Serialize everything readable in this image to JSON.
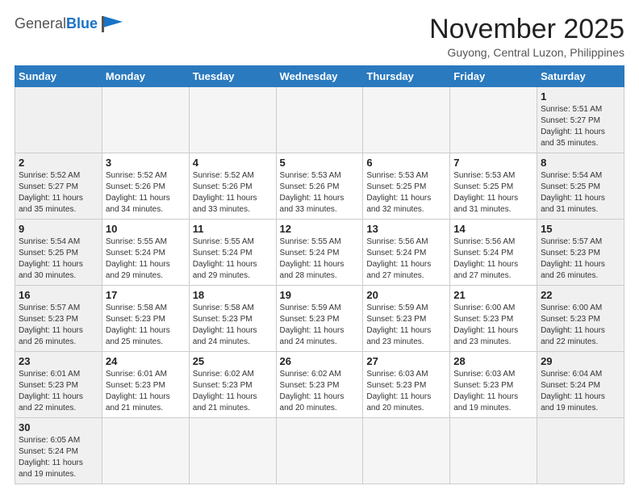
{
  "header": {
    "logo_general": "General",
    "logo_blue": "Blue",
    "month_title": "November 2025",
    "location": "Guyong, Central Luzon, Philippines"
  },
  "weekdays": [
    "Sunday",
    "Monday",
    "Tuesday",
    "Wednesday",
    "Thursday",
    "Friday",
    "Saturday"
  ],
  "weeks": [
    [
      {
        "day": "",
        "info": ""
      },
      {
        "day": "",
        "info": ""
      },
      {
        "day": "",
        "info": ""
      },
      {
        "day": "",
        "info": ""
      },
      {
        "day": "",
        "info": ""
      },
      {
        "day": "",
        "info": ""
      },
      {
        "day": "1",
        "info": "Sunrise: 5:51 AM\nSunset: 5:27 PM\nDaylight: 11 hours\nand 35 minutes."
      }
    ],
    [
      {
        "day": "2",
        "info": "Sunrise: 5:52 AM\nSunset: 5:27 PM\nDaylight: 11 hours\nand 35 minutes."
      },
      {
        "day": "3",
        "info": "Sunrise: 5:52 AM\nSunset: 5:26 PM\nDaylight: 11 hours\nand 34 minutes."
      },
      {
        "day": "4",
        "info": "Sunrise: 5:52 AM\nSunset: 5:26 PM\nDaylight: 11 hours\nand 33 minutes."
      },
      {
        "day": "5",
        "info": "Sunrise: 5:53 AM\nSunset: 5:26 PM\nDaylight: 11 hours\nand 33 minutes."
      },
      {
        "day": "6",
        "info": "Sunrise: 5:53 AM\nSunset: 5:25 PM\nDaylight: 11 hours\nand 32 minutes."
      },
      {
        "day": "7",
        "info": "Sunrise: 5:53 AM\nSunset: 5:25 PM\nDaylight: 11 hours\nand 31 minutes."
      },
      {
        "day": "8",
        "info": "Sunrise: 5:54 AM\nSunset: 5:25 PM\nDaylight: 11 hours\nand 31 minutes."
      }
    ],
    [
      {
        "day": "9",
        "info": "Sunrise: 5:54 AM\nSunset: 5:25 PM\nDaylight: 11 hours\nand 30 minutes."
      },
      {
        "day": "10",
        "info": "Sunrise: 5:55 AM\nSunset: 5:24 PM\nDaylight: 11 hours\nand 29 minutes."
      },
      {
        "day": "11",
        "info": "Sunrise: 5:55 AM\nSunset: 5:24 PM\nDaylight: 11 hours\nand 29 minutes."
      },
      {
        "day": "12",
        "info": "Sunrise: 5:55 AM\nSunset: 5:24 PM\nDaylight: 11 hours\nand 28 minutes."
      },
      {
        "day": "13",
        "info": "Sunrise: 5:56 AM\nSunset: 5:24 PM\nDaylight: 11 hours\nand 27 minutes."
      },
      {
        "day": "14",
        "info": "Sunrise: 5:56 AM\nSunset: 5:24 PM\nDaylight: 11 hours\nand 27 minutes."
      },
      {
        "day": "15",
        "info": "Sunrise: 5:57 AM\nSunset: 5:23 PM\nDaylight: 11 hours\nand 26 minutes."
      }
    ],
    [
      {
        "day": "16",
        "info": "Sunrise: 5:57 AM\nSunset: 5:23 PM\nDaylight: 11 hours\nand 26 minutes."
      },
      {
        "day": "17",
        "info": "Sunrise: 5:58 AM\nSunset: 5:23 PM\nDaylight: 11 hours\nand 25 minutes."
      },
      {
        "day": "18",
        "info": "Sunrise: 5:58 AM\nSunset: 5:23 PM\nDaylight: 11 hours\nand 24 minutes."
      },
      {
        "day": "19",
        "info": "Sunrise: 5:59 AM\nSunset: 5:23 PM\nDaylight: 11 hours\nand 24 minutes."
      },
      {
        "day": "20",
        "info": "Sunrise: 5:59 AM\nSunset: 5:23 PM\nDaylight: 11 hours\nand 23 minutes."
      },
      {
        "day": "21",
        "info": "Sunrise: 6:00 AM\nSunset: 5:23 PM\nDaylight: 11 hours\nand 23 minutes."
      },
      {
        "day": "22",
        "info": "Sunrise: 6:00 AM\nSunset: 5:23 PM\nDaylight: 11 hours\nand 22 minutes."
      }
    ],
    [
      {
        "day": "23",
        "info": "Sunrise: 6:01 AM\nSunset: 5:23 PM\nDaylight: 11 hours\nand 22 minutes."
      },
      {
        "day": "24",
        "info": "Sunrise: 6:01 AM\nSunset: 5:23 PM\nDaylight: 11 hours\nand 21 minutes."
      },
      {
        "day": "25",
        "info": "Sunrise: 6:02 AM\nSunset: 5:23 PM\nDaylight: 11 hours\nand 21 minutes."
      },
      {
        "day": "26",
        "info": "Sunrise: 6:02 AM\nSunset: 5:23 PM\nDaylight: 11 hours\nand 20 minutes."
      },
      {
        "day": "27",
        "info": "Sunrise: 6:03 AM\nSunset: 5:23 PM\nDaylight: 11 hours\nand 20 minutes."
      },
      {
        "day": "28",
        "info": "Sunrise: 6:03 AM\nSunset: 5:23 PM\nDaylight: 11 hours\nand 19 minutes."
      },
      {
        "day": "29",
        "info": "Sunrise: 6:04 AM\nSunset: 5:24 PM\nDaylight: 11 hours\nand 19 minutes."
      }
    ],
    [
      {
        "day": "30",
        "info": "Sunrise: 6:05 AM\nSunset: 5:24 PM\nDaylight: 11 hours\nand 19 minutes."
      },
      {
        "day": "",
        "info": ""
      },
      {
        "day": "",
        "info": ""
      },
      {
        "day": "",
        "info": ""
      },
      {
        "day": "",
        "info": ""
      },
      {
        "day": "",
        "info": ""
      },
      {
        "day": "",
        "info": ""
      }
    ]
  ]
}
